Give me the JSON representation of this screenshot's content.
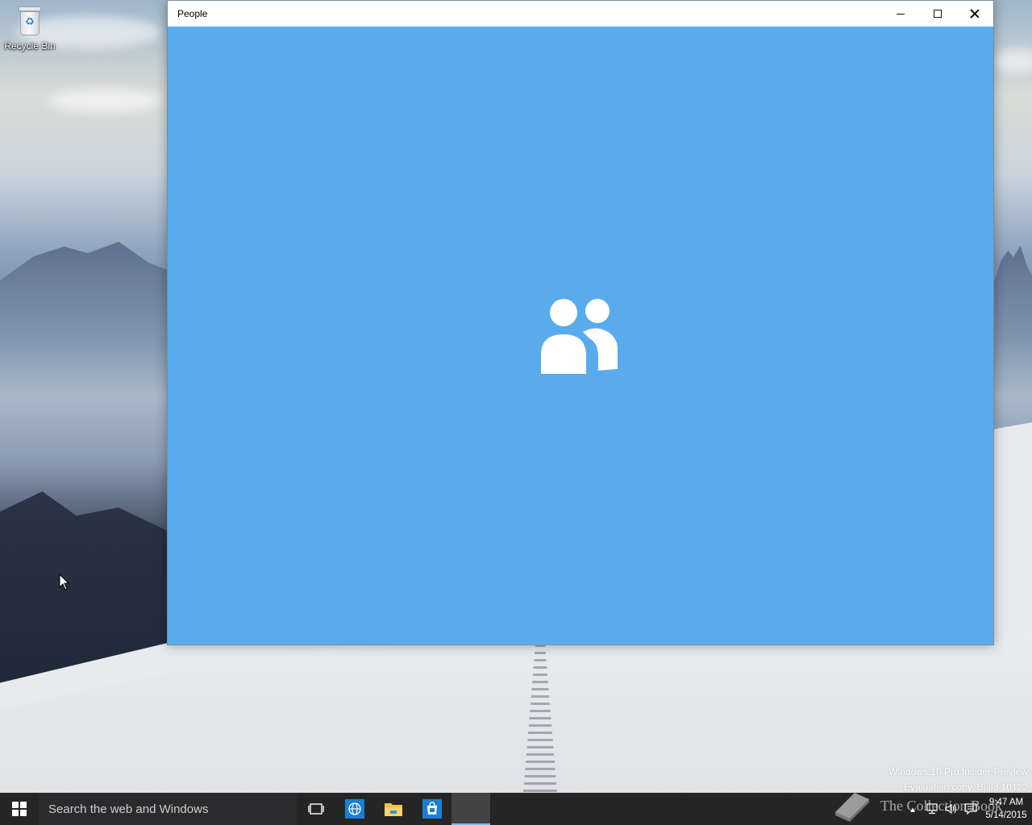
{
  "desktop": {
    "icons": [
      {
        "label": "Recycle Bin",
        "icon": "recycle-bin-icon"
      }
    ]
  },
  "window": {
    "title": "People",
    "background_color": "#5aabec",
    "logo_icon": "people-icon"
  },
  "watermark": {
    "line1": "Windows 10 Pro Insider Preview",
    "line2": "Evaluation copy. Build 10122"
  },
  "overlay": {
    "brand": "The Collection Book",
    "icon": "book-icon"
  },
  "taskbar": {
    "search_placeholder": "Search the web and Windows",
    "apps": [
      {
        "name": "task-view",
        "icon": "task-view-icon"
      },
      {
        "name": "internet-explorer",
        "icon": "globe-icon"
      },
      {
        "name": "file-explorer",
        "icon": "folder-icon"
      },
      {
        "name": "store",
        "icon": "store-icon"
      },
      {
        "name": "people",
        "icon": "people-icon",
        "active": true
      }
    ],
    "clock": {
      "time": "9:47 AM",
      "date": "5/14/2015"
    },
    "accent_color": "#76b9ed"
  }
}
